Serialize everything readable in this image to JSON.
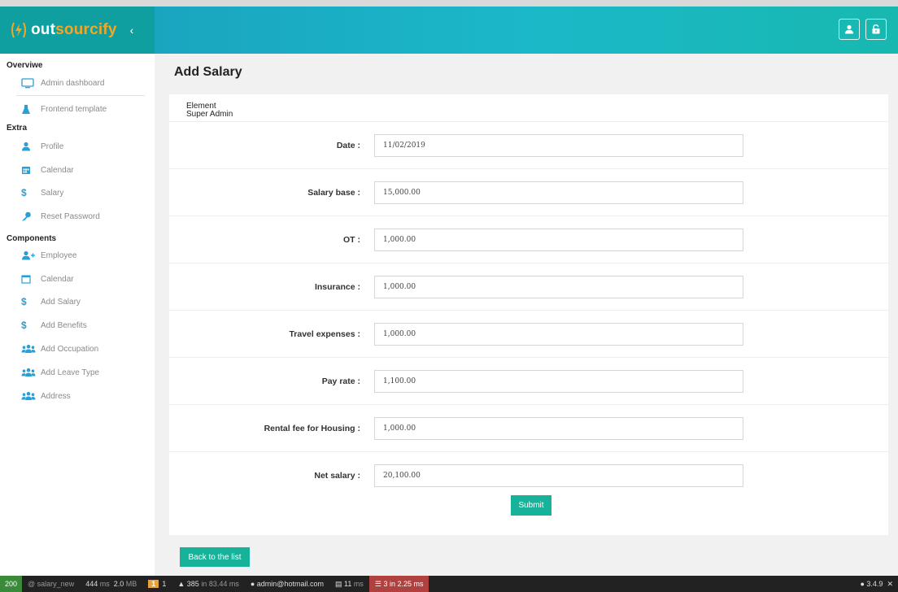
{
  "app": {
    "brand_prefix": "out",
    "brand_suffix": "sourcify",
    "collapse_icon": "chevron-left-icon"
  },
  "sidebar": {
    "sections": [
      {
        "title": "Overviwe"
      },
      {
        "title": "Extra"
      },
      {
        "title": "Components"
      }
    ],
    "items": [
      {
        "label": "Admin dashboard",
        "icon": "monitor-icon"
      },
      {
        "label": "Frontend template",
        "icon": "flask-icon"
      },
      {
        "label": "Profile",
        "icon": "user-icon"
      },
      {
        "label": "Calendar",
        "icon": "calendar-icon"
      },
      {
        "label": "Salary",
        "icon": "dollar-icon"
      },
      {
        "label": "Reset Password",
        "icon": "key-icon"
      },
      {
        "label": "Employee",
        "icon": "user-plus-icon"
      },
      {
        "label": "Calendar",
        "icon": "calendar-outline-icon"
      },
      {
        "label": "Add Salary",
        "icon": "dollar-icon"
      },
      {
        "label": "Add Benefits",
        "icon": "dollar-icon"
      },
      {
        "label": "Add Occupation",
        "icon": "users-icon"
      },
      {
        "label": "Add Leave Type",
        "icon": "users-icon"
      },
      {
        "label": "Address",
        "icon": "users-icon"
      }
    ]
  },
  "page": {
    "title": "Add Salary",
    "card_head_line1": "Element",
    "card_head_line2": "Super Admin",
    "fields": [
      {
        "label": "Date :",
        "value": "11/02/2019"
      },
      {
        "label": "Salary base :",
        "value": "15,000.00"
      },
      {
        "label": "OT :",
        "value": "1,000.00"
      },
      {
        "label": "Insurance :",
        "value": "1,000.00"
      },
      {
        "label": "Travel expenses :",
        "value": "1,000.00"
      },
      {
        "label": "Pay rate :",
        "value": "1,100.00"
      },
      {
        "label": "Rental fee for Housing :",
        "value": "1,000.00"
      },
      {
        "label": "Net salary :",
        "value": "20,100.00"
      }
    ],
    "submit_label": "Submit",
    "back_label": "Back to the list"
  },
  "debug_toolbar": {
    "status": "200",
    "route": "@ salary_new",
    "time": "444",
    "time_unit": "ms",
    "memory": "2.0",
    "memory_unit": "MB",
    "badge": "1",
    "badge_count": "1",
    "cache": "385",
    "cache_detail": "in 83.44 ms",
    "user": "admin@hotmail.com",
    "twig": "11",
    "twig_unit": "ms",
    "db": "3 in 2.25 ms",
    "version": "3.4.9"
  },
  "colors": {
    "brand": "#0f9fa0",
    "accent": "#17b29a",
    "brand_orange": "#f5a623"
  }
}
